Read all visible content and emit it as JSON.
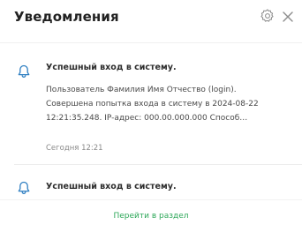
{
  "header": {
    "title": "Уведомления",
    "settings_icon": "gear-icon",
    "close_icon": "close-icon"
  },
  "notifications": [
    {
      "icon": "bell-icon",
      "title": "Успешный вход в систему.",
      "body_lines": [
        "Пользователь Фамилия Имя Отчество (login).",
        "Совершена попытка входа в систему в 2024-08-22",
        "12:21:35.248. IP-адрес: 000.00.000.000 Способ…"
      ],
      "time": "Сегодня 12:21"
    },
    {
      "icon": "bell-icon",
      "title": "Успешный вход в систему."
    }
  ],
  "footer": {
    "link_label": "Перейти в раздел"
  },
  "colors": {
    "accent": "#2fa85a",
    "bell": "#2f7fc2"
  }
}
